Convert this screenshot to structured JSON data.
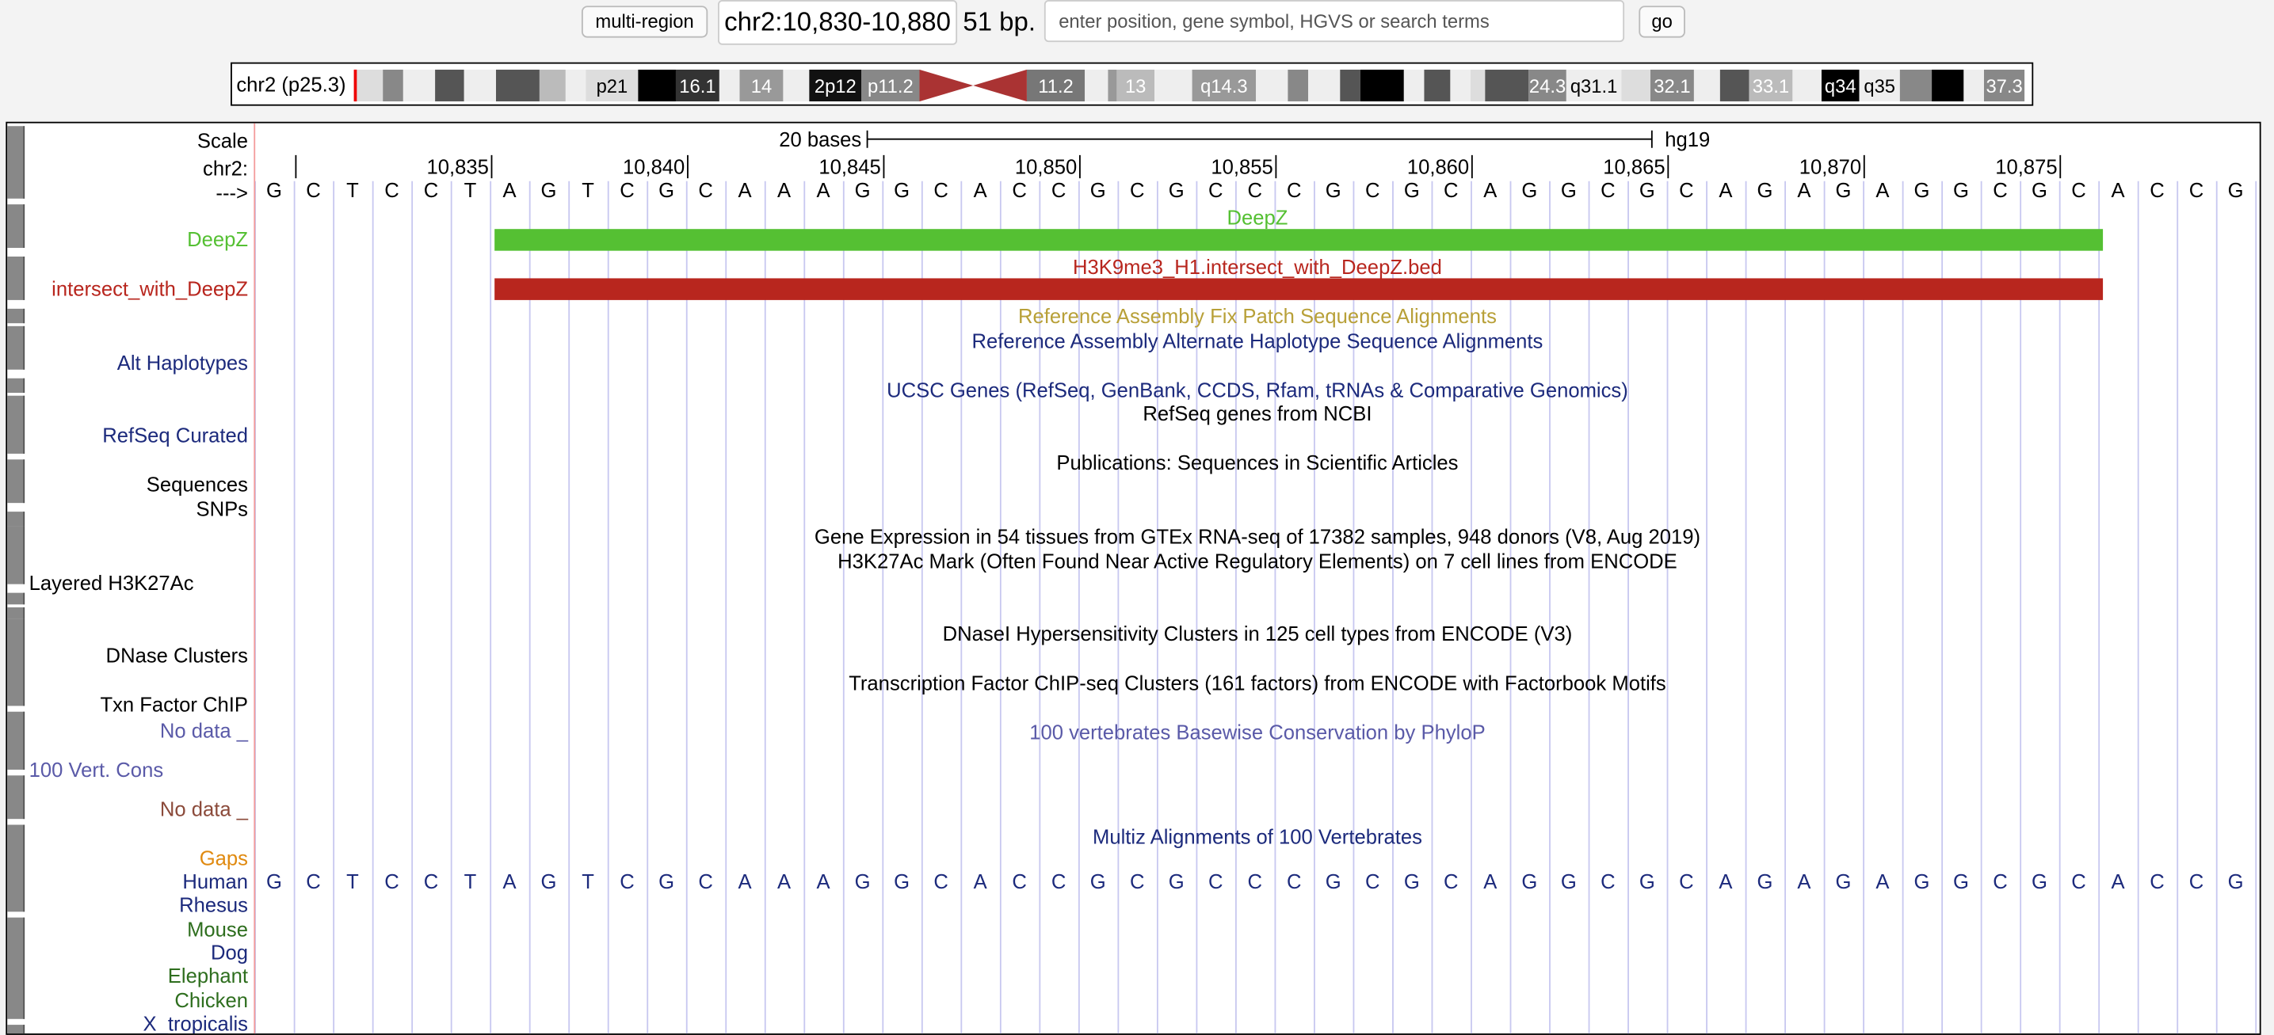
{
  "topbar": {
    "multi_region_label": "multi-region",
    "position": "chr2:10,830-10,880",
    "size": "51 bp.",
    "search_placeholder": "enter position, gene symbol, HGVS or search terms",
    "go_label": "go"
  },
  "ideogram": {
    "label": "chr2 (p25.3)",
    "bands": [
      "p21",
      "16.1",
      "14",
      "2p12",
      "p11.2",
      "11.2",
      "13",
      "q14.3",
      "24.3",
      "q31.1",
      "32.1",
      "33.1",
      "q34",
      "q35",
      "37.3"
    ]
  },
  "scale": {
    "label": "Scale",
    "bar_text": "20 bases",
    "assembly": "hg19",
    "chrom_label": "chr2:",
    "strand_label": "--->",
    "ticks": [
      "10,835",
      "10,840",
      "10,845",
      "10,850",
      "10,855",
      "10,860",
      "10,865",
      "10,870",
      "10,875"
    ]
  },
  "bases": [
    "G",
    "C",
    "T",
    "C",
    "C",
    "T",
    "A",
    "G",
    "T",
    "C",
    "G",
    "C",
    "A",
    "A",
    "A",
    "G",
    "G",
    "C",
    "A",
    "C",
    "C",
    "G",
    "C",
    "G",
    "C",
    "C",
    "C",
    "G",
    "C",
    "G",
    "C",
    "A",
    "G",
    "G",
    "C",
    "G",
    "C",
    "A",
    "G",
    "A",
    "G",
    "A",
    "G",
    "G",
    "C",
    "G",
    "C",
    "A",
    "C",
    "C",
    "G"
  ],
  "tracks": {
    "deepz": {
      "label": "DeepZ",
      "title": "DeepZ"
    },
    "intersect": {
      "label": "intersect_with_DeepZ",
      "title": "H3K9me3_H1.intersect_with_DeepZ.bed"
    },
    "fix_patch": "Reference Assembly Fix Patch Sequence Alignments",
    "alt_haplo": {
      "label": "Alt Haplotypes",
      "title": "Reference Assembly Alternate Haplotype Sequence Alignments"
    },
    "ucsc_genes": "UCSC Genes (RefSeq, GenBank, CCDS, Rfam, tRNAs & Comparative Genomics)",
    "refseq": {
      "label": "RefSeq Curated",
      "title": "RefSeq genes from NCBI"
    },
    "publications": {
      "label": "Sequences",
      "title": "Publications: Sequences in Scientific Articles"
    },
    "snps": {
      "label": "SNPs"
    },
    "gtex": "Gene Expression in 54 tissues from GTEx RNA-seq of 17382 samples, 948 donors (V8, Aug 2019)",
    "h3k27ac": {
      "label": "Layered H3K27Ac",
      "title": "H3K27Ac Mark (Often Found Near Active Regulatory Elements) on 7 cell lines from ENCODE"
    },
    "dnase": {
      "label": "DNase Clusters",
      "title": "DNaseI Hypersensitivity Clusters in 125 cell types from ENCODE (V3)"
    },
    "txn": {
      "label": "Txn Factor ChIP",
      "title": "Transcription Factor ChIP-seq Clusters (161 factors) from ENCODE with Factorbook Motifs"
    },
    "phylop": {
      "no_data": "No data _",
      "label": "100 Vert. Cons",
      "title": "100 vertebrates Basewise Conservation by PhyloP",
      "no_data2": "No data _"
    },
    "multiz": {
      "title": "Multiz Alignments of 100 Vertebrates",
      "gaps": "Gaps",
      "species": [
        "Human",
        "Rhesus",
        "Mouse",
        "Dog",
        "Elephant",
        "Chicken",
        "X_tropicalis"
      ]
    }
  },
  "colors": {
    "deepz": "#55c033",
    "intersect": "#b8261e",
    "navy": "#1c2a7c",
    "gold": "#b8a038",
    "green_species": "#2e6e1e",
    "phylop_blue": "#5a5aa8",
    "phylop_brown": "#8b4a3a",
    "gaps_orange": "#e08a10",
    "grid": "#c8c8f0"
  }
}
